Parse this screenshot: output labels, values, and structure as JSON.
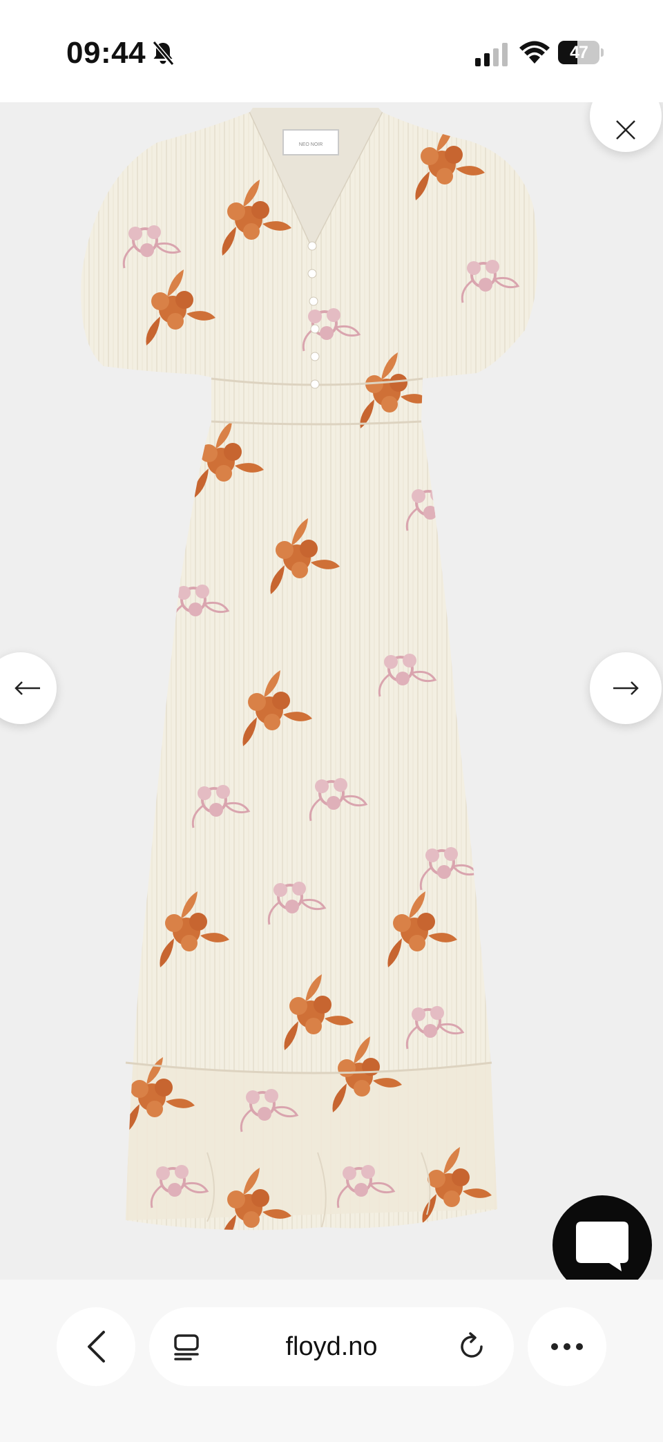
{
  "status_bar": {
    "time": "09:44",
    "battery_level": "47",
    "icons": [
      "bell-off-icon",
      "signal-icon",
      "wifi-icon",
      "battery-icon"
    ]
  },
  "viewer": {
    "product_image_alt": "Floral dress",
    "background": "#efefef",
    "brand_tag": "NEO NOIR",
    "controls": [
      "close-icon",
      "arrow-left-icon",
      "arrow-right-icon",
      "chat-icon"
    ]
  },
  "browser": {
    "url": "floyd.no",
    "icons": [
      "back-chevron-icon",
      "tabs-icon",
      "reload-icon",
      "more-icon"
    ]
  },
  "colors": {
    "chat_button": "#0b0b0b",
    "dress_base": "#f3efe2",
    "flower_orange": "#cf7037",
    "flower_pink": "#d9a4ae"
  }
}
